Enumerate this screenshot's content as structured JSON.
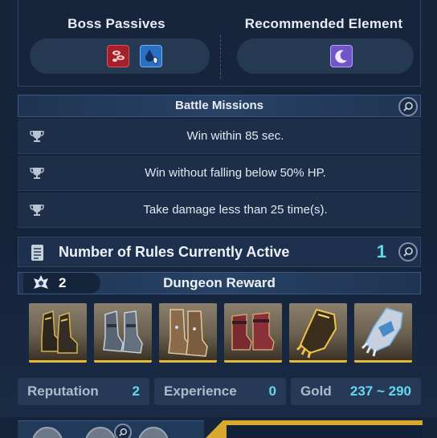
{
  "top": {
    "boss_passives_title": "Boss Passives",
    "recommended_element_title": "Recommended Element",
    "boss_passive_icons": [
      "blood-drops-icon",
      "water-shield-icon"
    ],
    "element_icon": "moon-icon"
  },
  "missions": {
    "title": "Battle Missions",
    "items": [
      {
        "icon": "trophy-icon",
        "text": "Win within 85 sec."
      },
      {
        "icon": "trophy-icon",
        "text": "Win without falling below 50% HP."
      },
      {
        "icon": "trophy-icon",
        "text": "Take damage less than 25 time(s)."
      }
    ]
  },
  "rules": {
    "label": "Number of Rules Currently Active",
    "count": "1"
  },
  "reward": {
    "title": "Dungeon Reward",
    "badge_count": "2",
    "items": [
      "boots-dark-gold",
      "boots-steel",
      "boots-bronze-plated",
      "boots-crimson",
      "gauntlet-gold",
      "gauntlet-silver-blue"
    ]
  },
  "stats": {
    "reputation_label": "Reputation",
    "reputation_value": "2",
    "experience_label": "Experience",
    "experience_value": "0",
    "gold_label": "Gold",
    "gold_value": "237 ~ 290"
  },
  "colors": {
    "accent_cyan": "#63d8ee",
    "gold_border": "#e6b838",
    "panel_bg": "#16263c"
  }
}
